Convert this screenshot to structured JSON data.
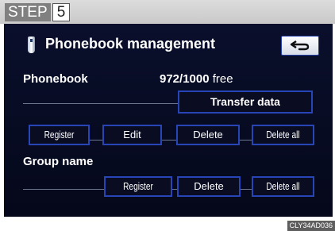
{
  "step": {
    "label": "STEP",
    "number": "5"
  },
  "header": {
    "title": "Phonebook management",
    "back_icon": "return-arrow-icon"
  },
  "phonebook": {
    "label": "Phonebook",
    "count": "972/1000",
    "count_suffix": "free",
    "transfer_label": "Transfer data"
  },
  "phonebook_buttons": {
    "register": "Register",
    "edit": "Edit",
    "delete": "Delete",
    "delete_all": "Delete all"
  },
  "group": {
    "label": "Group name",
    "register": "Register",
    "delete": "Delete",
    "delete_all": "Delete all"
  },
  "footer": {
    "code": "CLY34AD036"
  },
  "colors": {
    "screen_bg": "#0a0f2c",
    "button_border": "#2845b8",
    "text": "#ffffff"
  }
}
